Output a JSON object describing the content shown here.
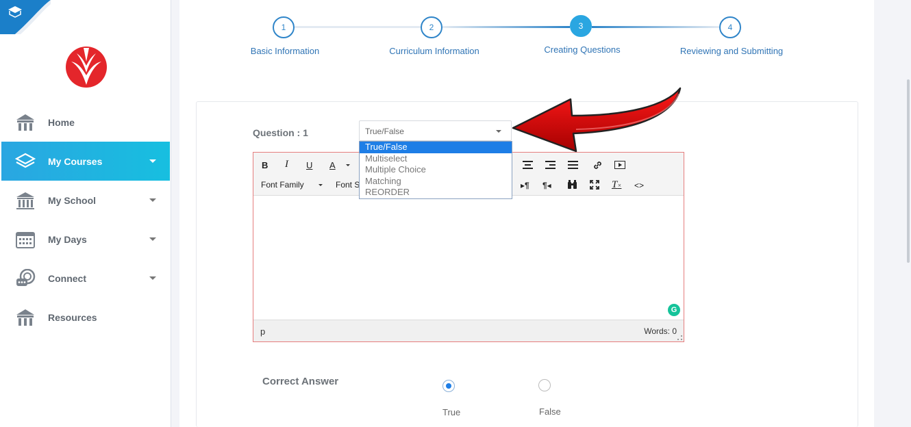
{
  "sidebar": {
    "items": [
      {
        "label": "Home",
        "icon": "building-icon",
        "dropdown": false,
        "active": false
      },
      {
        "label": "My Courses",
        "icon": "layers-icon",
        "dropdown": true,
        "active": true
      },
      {
        "label": "My School",
        "icon": "school-icon",
        "dropdown": true,
        "active": false
      },
      {
        "label": "My Days",
        "icon": "calendar-icon",
        "dropdown": true,
        "active": false
      },
      {
        "label": "Connect",
        "icon": "chat-icon",
        "dropdown": true,
        "active": false
      },
      {
        "label": "Resources",
        "icon": "building-icon",
        "dropdown": false,
        "active": false
      }
    ]
  },
  "stepper": {
    "steps": [
      {
        "number": "1",
        "label": "Basic Information"
      },
      {
        "number": "2",
        "label": "Curriculum Information"
      },
      {
        "number": "3",
        "label": "Creating Questions"
      },
      {
        "number": "4",
        "label": "Reviewing and Submitting"
      }
    ],
    "current_step": 3
  },
  "question": {
    "label": "Question : 1",
    "type_selected": "True/False",
    "type_options": [
      "True/False",
      "Multiselect",
      "Multiple Choice",
      "Matching",
      "REORDER"
    ]
  },
  "editor": {
    "toolbar": {
      "bold": "B",
      "italic": "I",
      "underline": "U",
      "font_color": "A",
      "font_family": "Font Family",
      "font_size_partial": "Font S"
    },
    "status_path": "p",
    "word_count": "Words: 0"
  },
  "answer": {
    "label": "Correct Answer",
    "options": [
      {
        "label": "True",
        "checked": true
      },
      {
        "label": "False",
        "checked": false
      }
    ]
  },
  "colors": {
    "accent": "#2aa6e1",
    "step_blue": "#2f85c9",
    "selected_option": "#1e7ee6",
    "arrow_red": "#d40000",
    "brand_red": "#e4262b"
  }
}
